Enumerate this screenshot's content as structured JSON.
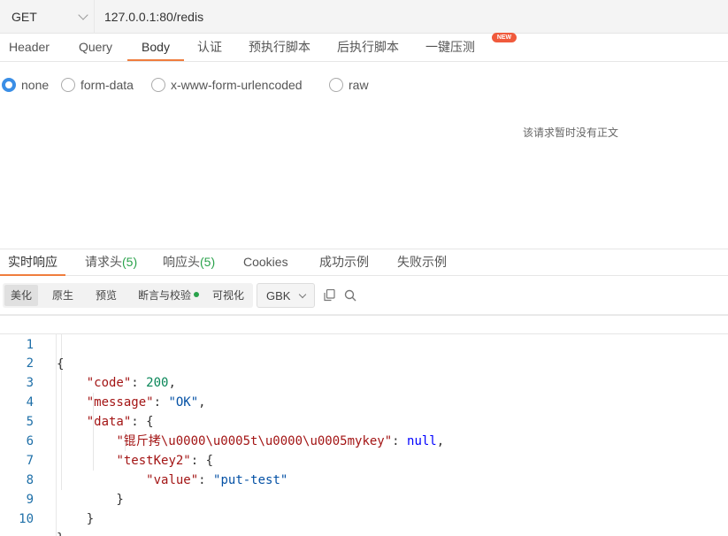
{
  "request": {
    "method": "GET",
    "url": "127.0.0.1:80/redis"
  },
  "req_tabs": [
    {
      "label": "Header"
    },
    {
      "label": "Query"
    },
    {
      "label": "Body"
    },
    {
      "label": "认证"
    },
    {
      "label": "预执行脚本"
    },
    {
      "label": "后执行脚本"
    },
    {
      "label": "一键压测"
    }
  ],
  "new_badge": "NEW",
  "body_types": [
    {
      "label": "none",
      "checked": true
    },
    {
      "label": "form-data",
      "checked": false
    },
    {
      "label": "x-www-form-urlencoded",
      "checked": false
    },
    {
      "label": "raw",
      "checked": false
    }
  ],
  "empty_body_message": "该请求暂时没有正文",
  "resp_tabs": [
    {
      "label": "实时响应"
    },
    {
      "label": "请求头",
      "count": "(5)"
    },
    {
      "label": "响应头",
      "count": "(5)"
    },
    {
      "label": "Cookies"
    },
    {
      "label": "成功示例"
    },
    {
      "label": "失败示例"
    }
  ],
  "view_modes": [
    {
      "label": "美化"
    },
    {
      "label": "原生"
    },
    {
      "label": "预览"
    },
    {
      "label": "断言与校验"
    },
    {
      "label": "可视化"
    }
  ],
  "encoding": "GBK",
  "icons": {
    "copy": "copy-icon",
    "search": "search-icon"
  },
  "colors": {
    "accent": "#f07d3d",
    "radio": "#3a8ee6",
    "count": "#2aa24b",
    "badge": "#f05a3c"
  },
  "code_lines": [
    {
      "n": "1",
      "p1": "{"
    },
    {
      "n": "2",
      "p1": "    ",
      "k": "\"code\"",
      "p2": ": ",
      "num": "200",
      "p3": ","
    },
    {
      "n": "3",
      "p1": "    ",
      "k": "\"message\"",
      "p2": ": ",
      "s": "\"OK\"",
      "p3": ","
    },
    {
      "n": "4",
      "p1": "    ",
      "k": "\"data\"",
      "p2": ": {"
    },
    {
      "n": "5",
      "p1": "        ",
      "k": "\"锟斤拷\\u0000\\u0005t\\u0000\\u0005mykey\"",
      "p2": ": ",
      "kw": "null",
      "p3": ","
    },
    {
      "n": "6",
      "p1": "        ",
      "k": "\"testKey2\"",
      "p2": ": {"
    },
    {
      "n": "7",
      "p1": "            ",
      "k": "\"value\"",
      "p2": ": ",
      "s": "\"put-test\""
    },
    {
      "n": "8",
      "p1": "        }"
    },
    {
      "n": "9",
      "p1": "    }"
    },
    {
      "n": "10",
      "p1": "}"
    }
  ]
}
